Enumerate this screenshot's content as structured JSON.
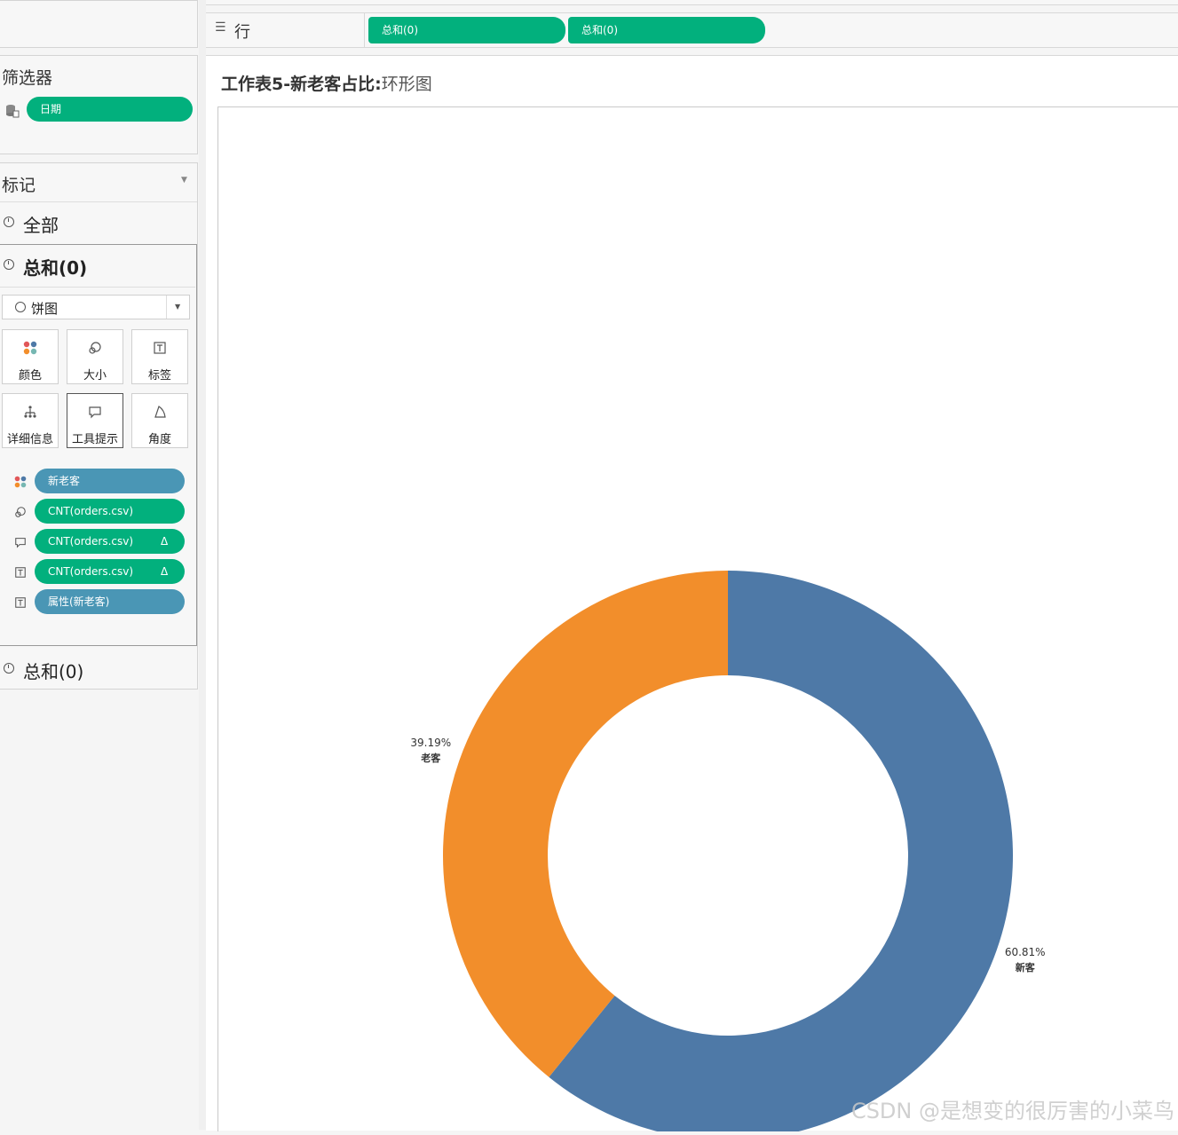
{
  "shelf": {
    "rows_label": "行",
    "pills": [
      "总和(0)",
      "总和(0)"
    ]
  },
  "filters": {
    "title": "筛选器",
    "items": [
      "日期"
    ]
  },
  "marks": {
    "title": "标记",
    "all_label": "全部",
    "active_label": "总和(0)",
    "mark_type": "饼图",
    "buttons": [
      "颜色",
      "大小",
      "标签",
      "详细信息",
      "工具提示",
      "角度"
    ],
    "fields": [
      {
        "icon": "color-icon",
        "label": "新老客",
        "color": "#4a96b5"
      },
      {
        "icon": "size-icon",
        "label": "CNT(orders.csv)",
        "color": "#02b07d"
      },
      {
        "icon": "tooltip-icon",
        "label": "CNT(orders.csv)",
        "color": "#02b07d",
        "delta": "Δ"
      },
      {
        "icon": "label-icon",
        "label": "CNT(orders.csv)",
        "color": "#02b07d",
        "delta": "Δ"
      },
      {
        "icon": "label-icon",
        "label": "属性(新老客)",
        "color": "#4a96b5"
      }
    ],
    "second_label": "总和(0)"
  },
  "worksheet": {
    "title_bold": "工作表5-新老客占比:",
    "title_light": "环形图"
  },
  "chart_data": {
    "type": "pie",
    "categories": [
      "新客",
      "老客"
    ],
    "values": [
      60.81,
      39.19
    ],
    "value_labels": [
      "60.81%",
      "39.19%"
    ],
    "colors": [
      "#4e79a7",
      "#f28e2b"
    ],
    "donut": true
  },
  "watermark": "CSDN @是想变的很厉害的小菜鸟"
}
